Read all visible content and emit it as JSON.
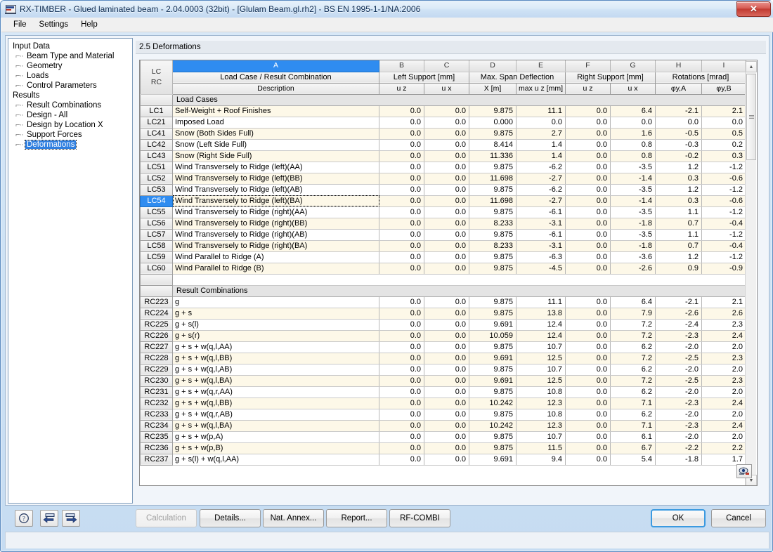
{
  "window": {
    "title": "RX-TIMBER - Glued laminated beam - 2.04.0003 (32bit) - [Glulam Beam.gl.rh2] - BS EN 1995-1-1/NA:2006",
    "close_label": "✕"
  },
  "menu": {
    "items": [
      {
        "label": "File"
      },
      {
        "label": "Settings"
      },
      {
        "label": "Help"
      }
    ]
  },
  "tree": {
    "groups": [
      {
        "label": "Input Data",
        "children": [
          {
            "label": "Beam Type and Material",
            "selected": false
          },
          {
            "label": "Geometry",
            "selected": false
          },
          {
            "label": "Loads",
            "selected": false
          },
          {
            "label": "Control Parameters",
            "selected": false
          }
        ]
      },
      {
        "label": "Results",
        "children": [
          {
            "label": "Result Combinations",
            "selected": false
          },
          {
            "label": "Design - All",
            "selected": false
          },
          {
            "label": "Design by Location X",
            "selected": false
          },
          {
            "label": "Support Forces",
            "selected": false
          },
          {
            "label": "Deformations",
            "selected": true
          }
        ]
      }
    ]
  },
  "section": {
    "title": "2.5 Deformations"
  },
  "table": {
    "column_letters": [
      "",
      "A",
      "B",
      "C",
      "D",
      "E",
      "F",
      "G",
      "H",
      "I"
    ],
    "selected_column_letter": "A",
    "index_header": {
      "line1": "LC",
      "line2": "RC"
    },
    "group_headers": [
      {
        "label": "Load Case / Result Combination",
        "span": 1
      },
      {
        "label": "Left Support [mm]",
        "span": 2
      },
      {
        "label": "Max. Span Deflection",
        "span": 2
      },
      {
        "label": "Right Support [mm]",
        "span": 2
      },
      {
        "label": "Rotations [mrad]",
        "span": 2
      }
    ],
    "sub_headers": [
      "Description",
      "u z",
      "u x",
      "X [m]",
      "max u z [mm]",
      "u z",
      "u x",
      "φy,A",
      "φy,B"
    ],
    "section_label_load_cases": "Load Cases",
    "section_label_result_combinations": "Result Combinations",
    "selected_row_id": "LC54",
    "load_cases": [
      {
        "id": "LC1",
        "desc": "Self-Weight + Roof Finishes",
        "ls_uz": "0.0",
        "ls_ux": "0.0",
        "x": "9.875",
        "maxuz": "11.1",
        "rs_uz": "0.0",
        "rs_ux": "6.4",
        "phiA": "-2.1",
        "phiB": "2.1"
      },
      {
        "id": "LC21",
        "desc": "Imposed Load",
        "ls_uz": "0.0",
        "ls_ux": "0.0",
        "x": "0.000",
        "maxuz": "0.0",
        "rs_uz": "0.0",
        "rs_ux": "0.0",
        "phiA": "0.0",
        "phiB": "0.0"
      },
      {
        "id": "LC41",
        "desc": "Snow (Both Sides Full)",
        "ls_uz": "0.0",
        "ls_ux": "0.0",
        "x": "9.875",
        "maxuz": "2.7",
        "rs_uz": "0.0",
        "rs_ux": "1.6",
        "phiA": "-0.5",
        "phiB": "0.5"
      },
      {
        "id": "LC42",
        "desc": "Snow (Left Side Full)",
        "ls_uz": "0.0",
        "ls_ux": "0.0",
        "x": "8.414",
        "maxuz": "1.4",
        "rs_uz": "0.0",
        "rs_ux": "0.8",
        "phiA": "-0.3",
        "phiB": "0.2"
      },
      {
        "id": "LC43",
        "desc": "Snow (Right Side Full)",
        "ls_uz": "0.0",
        "ls_ux": "0.0",
        "x": "11.336",
        "maxuz": "1.4",
        "rs_uz": "0.0",
        "rs_ux": "0.8",
        "phiA": "-0.2",
        "phiB": "0.3"
      },
      {
        "id": "LC51",
        "desc": "Wind Transversely to Ridge (left)(AA)",
        "ls_uz": "0.0",
        "ls_ux": "0.0",
        "x": "9.875",
        "maxuz": "-6.2",
        "rs_uz": "0.0",
        "rs_ux": "-3.5",
        "phiA": "1.2",
        "phiB": "-1.2"
      },
      {
        "id": "LC52",
        "desc": "Wind Transversely to Ridge (left)(BB)",
        "ls_uz": "0.0",
        "ls_ux": "0.0",
        "x": "11.698",
        "maxuz": "-2.7",
        "rs_uz": "0.0",
        "rs_ux": "-1.4",
        "phiA": "0.3",
        "phiB": "-0.6"
      },
      {
        "id": "LC53",
        "desc": "Wind Transversely to Ridge (left)(AB)",
        "ls_uz": "0.0",
        "ls_ux": "0.0",
        "x": "9.875",
        "maxuz": "-6.2",
        "rs_uz": "0.0",
        "rs_ux": "-3.5",
        "phiA": "1.2",
        "phiB": "-1.2"
      },
      {
        "id": "LC54",
        "desc": "Wind Transversely to Ridge (left)(BA)",
        "ls_uz": "0.0",
        "ls_ux": "0.0",
        "x": "11.698",
        "maxuz": "-2.7",
        "rs_uz": "0.0",
        "rs_ux": "-1.4",
        "phiA": "0.3",
        "phiB": "-0.6"
      },
      {
        "id": "LC55",
        "desc": "Wind Transversely to Ridge (right)(AA)",
        "ls_uz": "0.0",
        "ls_ux": "0.0",
        "x": "9.875",
        "maxuz": "-6.1",
        "rs_uz": "0.0",
        "rs_ux": "-3.5",
        "phiA": "1.1",
        "phiB": "-1.2"
      },
      {
        "id": "LC56",
        "desc": "Wind Transversely to Ridge (right)(BB)",
        "ls_uz": "0.0",
        "ls_ux": "0.0",
        "x": "8.233",
        "maxuz": "-3.1",
        "rs_uz": "0.0",
        "rs_ux": "-1.8",
        "phiA": "0.7",
        "phiB": "-0.4"
      },
      {
        "id": "LC57",
        "desc": "Wind Transversely to Ridge (right)(AB)",
        "ls_uz": "0.0",
        "ls_ux": "0.0",
        "x": "9.875",
        "maxuz": "-6.1",
        "rs_uz": "0.0",
        "rs_ux": "-3.5",
        "phiA": "1.1",
        "phiB": "-1.2"
      },
      {
        "id": "LC58",
        "desc": "Wind Transversely to Ridge (right)(BA)",
        "ls_uz": "0.0",
        "ls_ux": "0.0",
        "x": "8.233",
        "maxuz": "-3.1",
        "rs_uz": "0.0",
        "rs_ux": "-1.8",
        "phiA": "0.7",
        "phiB": "-0.4"
      },
      {
        "id": "LC59",
        "desc": "Wind Parallel to Ridge (A)",
        "ls_uz": "0.0",
        "ls_ux": "0.0",
        "x": "9.875",
        "maxuz": "-6.3",
        "rs_uz": "0.0",
        "rs_ux": "-3.6",
        "phiA": "1.2",
        "phiB": "-1.2"
      },
      {
        "id": "LC60",
        "desc": "Wind Parallel to Ridge (B)",
        "ls_uz": "0.0",
        "ls_ux": "0.0",
        "x": "9.875",
        "maxuz": "-4.5",
        "rs_uz": "0.0",
        "rs_ux": "-2.6",
        "phiA": "0.9",
        "phiB": "-0.9"
      }
    ],
    "result_combinations": [
      {
        "id": "RC223",
        "desc": "g",
        "ls_uz": "0.0",
        "ls_ux": "0.0",
        "x": "9.875",
        "maxuz": "11.1",
        "rs_uz": "0.0",
        "rs_ux": "6.4",
        "phiA": "-2.1",
        "phiB": "2.1"
      },
      {
        "id": "RC224",
        "desc": "g + s",
        "ls_uz": "0.0",
        "ls_ux": "0.0",
        "x": "9.875",
        "maxuz": "13.8",
        "rs_uz": "0.0",
        "rs_ux": "7.9",
        "phiA": "-2.6",
        "phiB": "2.6"
      },
      {
        "id": "RC225",
        "desc": "g + s(l)",
        "ls_uz": "0.0",
        "ls_ux": "0.0",
        "x": "9.691",
        "maxuz": "12.4",
        "rs_uz": "0.0",
        "rs_ux": "7.2",
        "phiA": "-2.4",
        "phiB": "2.3"
      },
      {
        "id": "RC226",
        "desc": "g + s(r)",
        "ls_uz": "0.0",
        "ls_ux": "0.0",
        "x": "10.059",
        "maxuz": "12.4",
        "rs_uz": "0.0",
        "rs_ux": "7.2",
        "phiA": "-2.3",
        "phiB": "2.4"
      },
      {
        "id": "RC227",
        "desc": "g + s + w(q,l,AA)",
        "ls_uz": "0.0",
        "ls_ux": "0.0",
        "x": "9.875",
        "maxuz": "10.7",
        "rs_uz": "0.0",
        "rs_ux": "6.2",
        "phiA": "-2.0",
        "phiB": "2.0"
      },
      {
        "id": "RC228",
        "desc": "g + s + w(q,l,BB)",
        "ls_uz": "0.0",
        "ls_ux": "0.0",
        "x": "9.691",
        "maxuz": "12.5",
        "rs_uz": "0.0",
        "rs_ux": "7.2",
        "phiA": "-2.5",
        "phiB": "2.3"
      },
      {
        "id": "RC229",
        "desc": "g + s + w(q,l,AB)",
        "ls_uz": "0.0",
        "ls_ux": "0.0",
        "x": "9.875",
        "maxuz": "10.7",
        "rs_uz": "0.0",
        "rs_ux": "6.2",
        "phiA": "-2.0",
        "phiB": "2.0"
      },
      {
        "id": "RC230",
        "desc": "g + s + w(q,l,BA)",
        "ls_uz": "0.0",
        "ls_ux": "0.0",
        "x": "9.691",
        "maxuz": "12.5",
        "rs_uz": "0.0",
        "rs_ux": "7.2",
        "phiA": "-2.5",
        "phiB": "2.3"
      },
      {
        "id": "RC231",
        "desc": "g + s + w(q,r,AA)",
        "ls_uz": "0.0",
        "ls_ux": "0.0",
        "x": "9.875",
        "maxuz": "10.8",
        "rs_uz": "0.0",
        "rs_ux": "6.2",
        "phiA": "-2.0",
        "phiB": "2.0"
      },
      {
        "id": "RC232",
        "desc": "g + s + w(q,l,BB)",
        "ls_uz": "0.0",
        "ls_ux": "0.0",
        "x": "10.242",
        "maxuz": "12.3",
        "rs_uz": "0.0",
        "rs_ux": "7.1",
        "phiA": "-2.3",
        "phiB": "2.4"
      },
      {
        "id": "RC233",
        "desc": "g + s + w(q,r,AB)",
        "ls_uz": "0.0",
        "ls_ux": "0.0",
        "x": "9.875",
        "maxuz": "10.8",
        "rs_uz": "0.0",
        "rs_ux": "6.2",
        "phiA": "-2.0",
        "phiB": "2.0"
      },
      {
        "id": "RC234",
        "desc": "g + s + w(q,l,BA)",
        "ls_uz": "0.0",
        "ls_ux": "0.0",
        "x": "10.242",
        "maxuz": "12.3",
        "rs_uz": "0.0",
        "rs_ux": "7.1",
        "phiA": "-2.3",
        "phiB": "2.4"
      },
      {
        "id": "RC235",
        "desc": "g + s + w(p,A)",
        "ls_uz": "0.0",
        "ls_ux": "0.0",
        "x": "9.875",
        "maxuz": "10.7",
        "rs_uz": "0.0",
        "rs_ux": "6.1",
        "phiA": "-2.0",
        "phiB": "2.0"
      },
      {
        "id": "RC236",
        "desc": "g + s + w(p,B)",
        "ls_uz": "0.0",
        "ls_ux": "0.0",
        "x": "9.875",
        "maxuz": "11.5",
        "rs_uz": "0.0",
        "rs_ux": "6.7",
        "phiA": "-2.2",
        "phiB": "2.2"
      },
      {
        "id": "RC237",
        "desc": "g + s(l) + w(q,l,AA)",
        "ls_uz": "0.0",
        "ls_ux": "0.0",
        "x": "9.691",
        "maxuz": "9.4",
        "rs_uz": "0.0",
        "rs_ux": "5.4",
        "phiA": "-1.8",
        "phiB": "1.7"
      }
    ]
  },
  "buttons": {
    "help": "?",
    "prev": "◀",
    "next": "▶",
    "calculation": "Calculation",
    "details": "Details...",
    "nat_annex": "Nat. Annex...",
    "report": "Report...",
    "rf_combi": "RF-COMBI",
    "ok": "OK",
    "cancel": "Cancel"
  },
  "colors": {
    "selection": "#2f8cf0",
    "row_alt": "#fdf8e8",
    "title_text": "#0b2a50"
  }
}
